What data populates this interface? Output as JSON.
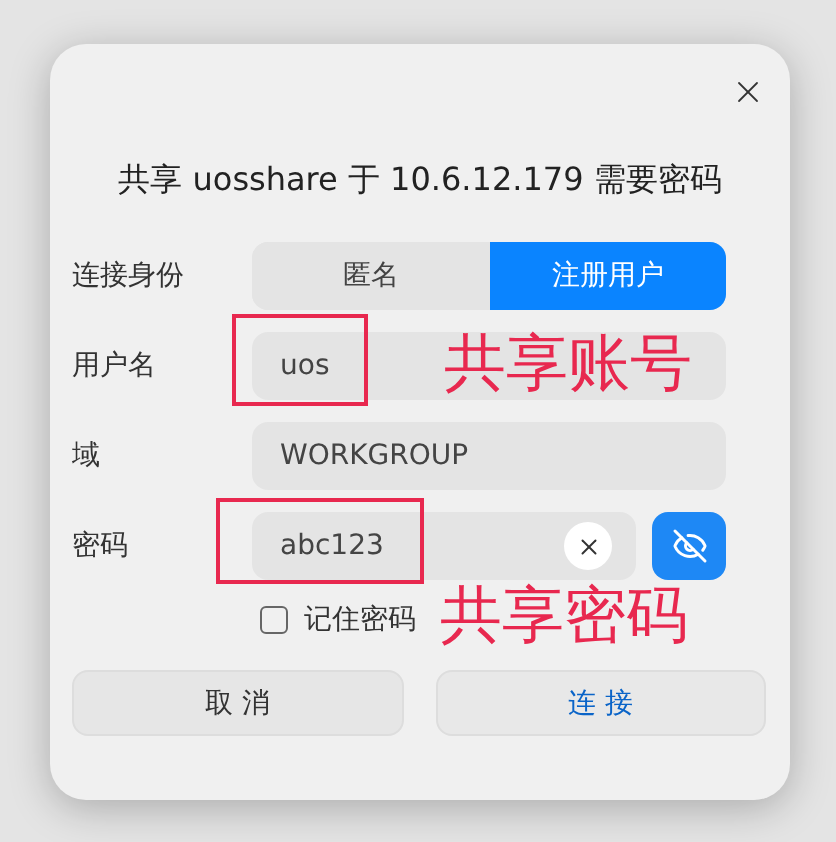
{
  "dialog": {
    "title": "共享 uosshare 于 10.6.12.179 需要密码",
    "identity": {
      "label": "连接身份",
      "options": [
        {
          "label": "匿名",
          "selected": false
        },
        {
          "label": "注册用户",
          "selected": true
        }
      ]
    },
    "username": {
      "label": "用户名",
      "value": "uos",
      "annotation": "共享账号"
    },
    "domain": {
      "label": "域",
      "value": "WORKGROUP"
    },
    "password": {
      "label": "密码",
      "value": "abc123",
      "annotation": "共享密码"
    },
    "remember": {
      "label": "记住密码",
      "checked": false
    },
    "buttons": [
      {
        "label": "取 消",
        "kind": "secondary"
      },
      {
        "label": "连 接",
        "kind": "primary"
      }
    ]
  }
}
